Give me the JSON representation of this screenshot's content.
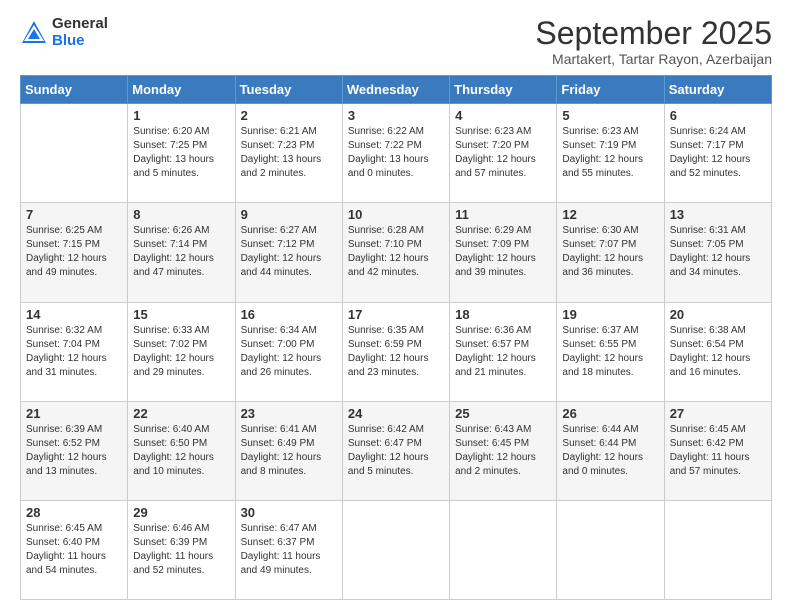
{
  "header": {
    "logo": {
      "general": "General",
      "blue": "Blue"
    },
    "title": "September 2025",
    "subtitle": "Martakert, Tartar Rayon, Azerbaijan"
  },
  "calendar": {
    "days_of_week": [
      "Sunday",
      "Monday",
      "Tuesday",
      "Wednesday",
      "Thursday",
      "Friday",
      "Saturday"
    ],
    "weeks": [
      [
        {
          "day": "",
          "sunrise": "",
          "sunset": "",
          "daylight": ""
        },
        {
          "day": "1",
          "sunrise": "Sunrise: 6:20 AM",
          "sunset": "Sunset: 7:25 PM",
          "daylight": "Daylight: 13 hours and 5 minutes."
        },
        {
          "day": "2",
          "sunrise": "Sunrise: 6:21 AM",
          "sunset": "Sunset: 7:23 PM",
          "daylight": "Daylight: 13 hours and 2 minutes."
        },
        {
          "day": "3",
          "sunrise": "Sunrise: 6:22 AM",
          "sunset": "Sunset: 7:22 PM",
          "daylight": "Daylight: 13 hours and 0 minutes."
        },
        {
          "day": "4",
          "sunrise": "Sunrise: 6:23 AM",
          "sunset": "Sunset: 7:20 PM",
          "daylight": "Daylight: 12 hours and 57 minutes."
        },
        {
          "day": "5",
          "sunrise": "Sunrise: 6:23 AM",
          "sunset": "Sunset: 7:19 PM",
          "daylight": "Daylight: 12 hours and 55 minutes."
        },
        {
          "day": "6",
          "sunrise": "Sunrise: 6:24 AM",
          "sunset": "Sunset: 7:17 PM",
          "daylight": "Daylight: 12 hours and 52 minutes."
        }
      ],
      [
        {
          "day": "7",
          "sunrise": "Sunrise: 6:25 AM",
          "sunset": "Sunset: 7:15 PM",
          "daylight": "Daylight: 12 hours and 49 minutes."
        },
        {
          "day": "8",
          "sunrise": "Sunrise: 6:26 AM",
          "sunset": "Sunset: 7:14 PM",
          "daylight": "Daylight: 12 hours and 47 minutes."
        },
        {
          "day": "9",
          "sunrise": "Sunrise: 6:27 AM",
          "sunset": "Sunset: 7:12 PM",
          "daylight": "Daylight: 12 hours and 44 minutes."
        },
        {
          "day": "10",
          "sunrise": "Sunrise: 6:28 AM",
          "sunset": "Sunset: 7:10 PM",
          "daylight": "Daylight: 12 hours and 42 minutes."
        },
        {
          "day": "11",
          "sunrise": "Sunrise: 6:29 AM",
          "sunset": "Sunset: 7:09 PM",
          "daylight": "Daylight: 12 hours and 39 minutes."
        },
        {
          "day": "12",
          "sunrise": "Sunrise: 6:30 AM",
          "sunset": "Sunset: 7:07 PM",
          "daylight": "Daylight: 12 hours and 36 minutes."
        },
        {
          "day": "13",
          "sunrise": "Sunrise: 6:31 AM",
          "sunset": "Sunset: 7:05 PM",
          "daylight": "Daylight: 12 hours and 34 minutes."
        }
      ],
      [
        {
          "day": "14",
          "sunrise": "Sunrise: 6:32 AM",
          "sunset": "Sunset: 7:04 PM",
          "daylight": "Daylight: 12 hours and 31 minutes."
        },
        {
          "day": "15",
          "sunrise": "Sunrise: 6:33 AM",
          "sunset": "Sunset: 7:02 PM",
          "daylight": "Daylight: 12 hours and 29 minutes."
        },
        {
          "day": "16",
          "sunrise": "Sunrise: 6:34 AM",
          "sunset": "Sunset: 7:00 PM",
          "daylight": "Daylight: 12 hours and 26 minutes."
        },
        {
          "day": "17",
          "sunrise": "Sunrise: 6:35 AM",
          "sunset": "Sunset: 6:59 PM",
          "daylight": "Daylight: 12 hours and 23 minutes."
        },
        {
          "day": "18",
          "sunrise": "Sunrise: 6:36 AM",
          "sunset": "Sunset: 6:57 PM",
          "daylight": "Daylight: 12 hours and 21 minutes."
        },
        {
          "day": "19",
          "sunrise": "Sunrise: 6:37 AM",
          "sunset": "Sunset: 6:55 PM",
          "daylight": "Daylight: 12 hours and 18 minutes."
        },
        {
          "day": "20",
          "sunrise": "Sunrise: 6:38 AM",
          "sunset": "Sunset: 6:54 PM",
          "daylight": "Daylight: 12 hours and 16 minutes."
        }
      ],
      [
        {
          "day": "21",
          "sunrise": "Sunrise: 6:39 AM",
          "sunset": "Sunset: 6:52 PM",
          "daylight": "Daylight: 12 hours and 13 minutes."
        },
        {
          "day": "22",
          "sunrise": "Sunrise: 6:40 AM",
          "sunset": "Sunset: 6:50 PM",
          "daylight": "Daylight: 12 hours and 10 minutes."
        },
        {
          "day": "23",
          "sunrise": "Sunrise: 6:41 AM",
          "sunset": "Sunset: 6:49 PM",
          "daylight": "Daylight: 12 hours and 8 minutes."
        },
        {
          "day": "24",
          "sunrise": "Sunrise: 6:42 AM",
          "sunset": "Sunset: 6:47 PM",
          "daylight": "Daylight: 12 hours and 5 minutes."
        },
        {
          "day": "25",
          "sunrise": "Sunrise: 6:43 AM",
          "sunset": "Sunset: 6:45 PM",
          "daylight": "Daylight: 12 hours and 2 minutes."
        },
        {
          "day": "26",
          "sunrise": "Sunrise: 6:44 AM",
          "sunset": "Sunset: 6:44 PM",
          "daylight": "Daylight: 12 hours and 0 minutes."
        },
        {
          "day": "27",
          "sunrise": "Sunrise: 6:45 AM",
          "sunset": "Sunset: 6:42 PM",
          "daylight": "Daylight: 11 hours and 57 minutes."
        }
      ],
      [
        {
          "day": "28",
          "sunrise": "Sunrise: 6:45 AM",
          "sunset": "Sunset: 6:40 PM",
          "daylight": "Daylight: 11 hours and 54 minutes."
        },
        {
          "day": "29",
          "sunrise": "Sunrise: 6:46 AM",
          "sunset": "Sunset: 6:39 PM",
          "daylight": "Daylight: 11 hours and 52 minutes."
        },
        {
          "day": "30",
          "sunrise": "Sunrise: 6:47 AM",
          "sunset": "Sunset: 6:37 PM",
          "daylight": "Daylight: 11 hours and 49 minutes."
        },
        {
          "day": "",
          "sunrise": "",
          "sunset": "",
          "daylight": ""
        },
        {
          "day": "",
          "sunrise": "",
          "sunset": "",
          "daylight": ""
        },
        {
          "day": "",
          "sunrise": "",
          "sunset": "",
          "daylight": ""
        },
        {
          "day": "",
          "sunrise": "",
          "sunset": "",
          "daylight": ""
        }
      ]
    ]
  }
}
